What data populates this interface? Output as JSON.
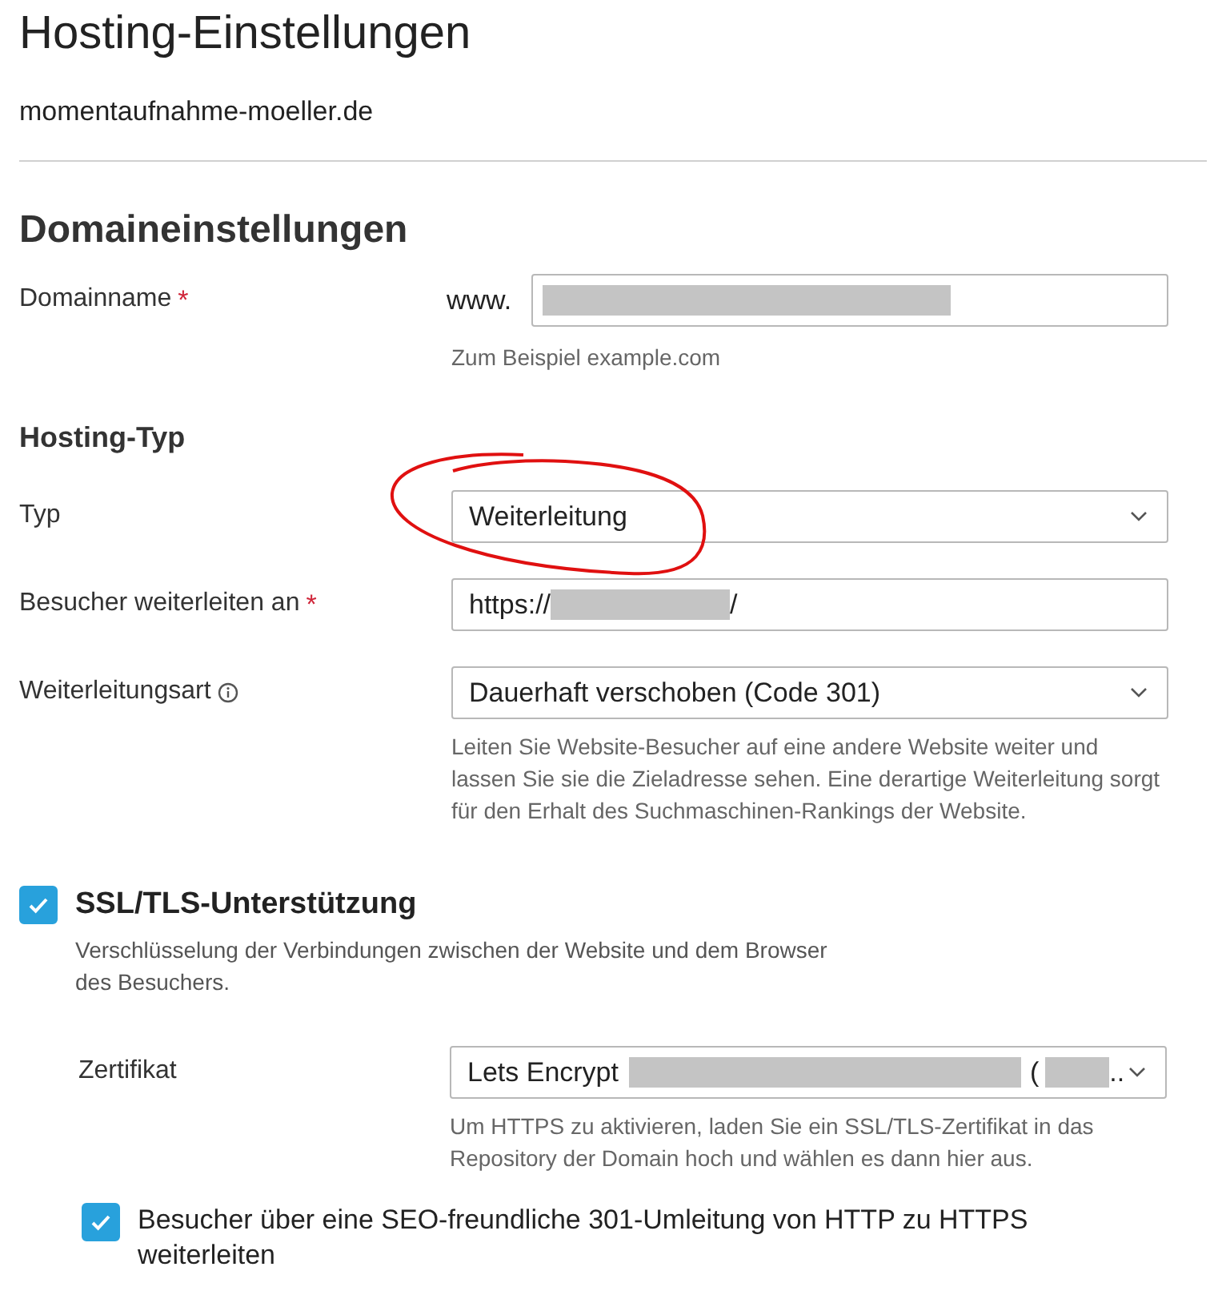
{
  "title": "Hosting-Einstellungen",
  "domain": "momentaufnahme-moeller.de",
  "section_title": "Domaineinstellungen",
  "domain_field": {
    "label": "Domainname",
    "required_mark": "*",
    "prefix": "www.",
    "value_parts": [
      {
        "kind": "redacted"
      }
    ],
    "hint": "Zum Beispiel example.com"
  },
  "hosting_title": "Hosting-Typ",
  "hosting_fields": [
    {
      "kind": "select",
      "label": "Typ",
      "info": false,
      "annotated": true,
      "value_parts": [
        {
          "kind": "text",
          "text": "Weiterleitung"
        }
      ]
    },
    {
      "kind": "input",
      "label": "Besucher weiterleiten an",
      "required_mark": "*",
      "info": false,
      "annotated": false,
      "value_parts": [
        {
          "kind": "text",
          "text": "https://"
        },
        {
          "kind": "redacted"
        },
        {
          "kind": "text",
          "text": "/"
        }
      ]
    },
    {
      "kind": "select",
      "label": "Weiterleitungsart",
      "info": true,
      "annotated": false,
      "value_parts": [
        {
          "kind": "text",
          "text": "Dauerhaft verschoben (Code 301)"
        }
      ],
      "hint": "Leiten Sie Website-Besucher auf eine andere Website weiter und lassen Sie sie die Zieladresse sehen. Eine derartige Weiterleitung sorgt für den Erhalt des Suchmaschinen-Rankings der Website."
    }
  ],
  "ssl": {
    "label": "SSL/TLS-Unterstützung",
    "checked": true,
    "description": "Verschlüsselung der Verbindungen zwischen der Website und dem Browser des Besuchers.",
    "certificate": {
      "label": "Zertifikat",
      "value_parts": [
        {
          "kind": "text",
          "text": "Lets Encrypt"
        },
        {
          "kind": "redacted"
        },
        {
          "kind": "text",
          "text": "("
        },
        {
          "kind": "redacted"
        },
        {
          "kind": "text",
          "text": ".."
        }
      ],
      "hint": "Um HTTPS zu aktivieren, laden Sie ein SSL/TLS-Zertifikat in das Repository der Domain hoch und wählen es dann hier aus."
    },
    "redirect": {
      "label": "Besucher über eine SEO-freundliche 301-Umleitung von HTTP zu HTTPS weiterleiten",
      "checked": true
    }
  }
}
